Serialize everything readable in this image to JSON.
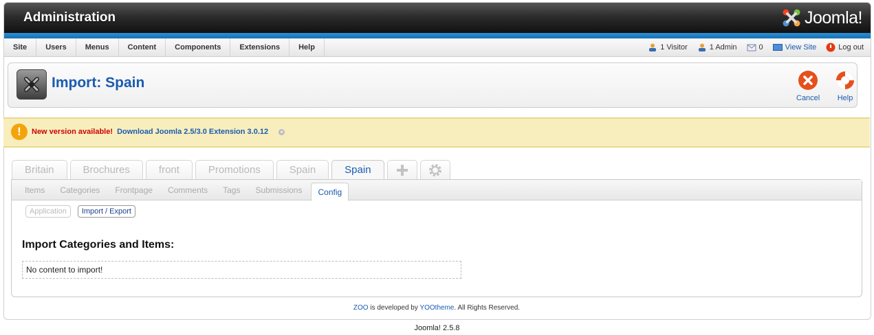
{
  "header": {
    "title": "Administration",
    "logo_text": "Joomla!"
  },
  "menu": {
    "items": [
      "Site",
      "Users",
      "Menus",
      "Content",
      "Components",
      "Extensions",
      "Help"
    ],
    "status": {
      "visitors": "1 Visitor",
      "admins": "1 Admin",
      "messages": "0",
      "view_site": "View Site",
      "logout": "Log out"
    }
  },
  "toolbar": {
    "title": "Import: Spain",
    "cancel_label": "Cancel",
    "help_label": "Help"
  },
  "notice": {
    "prefix": "New version available!",
    "link": "Download Joomla 2.5/3.0 Extension 3.0.12"
  },
  "app_tabs": [
    {
      "label": "Britain",
      "active": false
    },
    {
      "label": "Brochures",
      "active": false
    },
    {
      "label": "front",
      "active": false
    },
    {
      "label": "Promotions",
      "active": false
    },
    {
      "label": "Spain",
      "active": false
    },
    {
      "label": "Spain",
      "active": true
    }
  ],
  "sub_tabs": [
    {
      "label": "Items",
      "active": false
    },
    {
      "label": "Categories",
      "active": false
    },
    {
      "label": "Frontpage",
      "active": false
    },
    {
      "label": "Comments",
      "active": false
    },
    {
      "label": "Tags",
      "active": false
    },
    {
      "label": "Submissions",
      "active": false
    },
    {
      "label": "Config",
      "active": true
    }
  ],
  "pills": [
    {
      "label": "Application",
      "active": false
    },
    {
      "label": "Import / Export",
      "active": true
    }
  ],
  "content": {
    "section_title": "Import Categories and Items:",
    "empty_message": "No content to import!"
  },
  "footer": {
    "zoo": "ZOO",
    "middle": " is developed by ",
    "yootheme": "YOOtheme",
    "end": ". All Rights Reserved.",
    "version": "Joomla! 2.5.8"
  },
  "colors": {
    "link_blue": "#1a5bb0",
    "notice_bg": "#f8eebd",
    "warning_orange": "#f3a40c",
    "cancel_red": "#e5501e"
  }
}
